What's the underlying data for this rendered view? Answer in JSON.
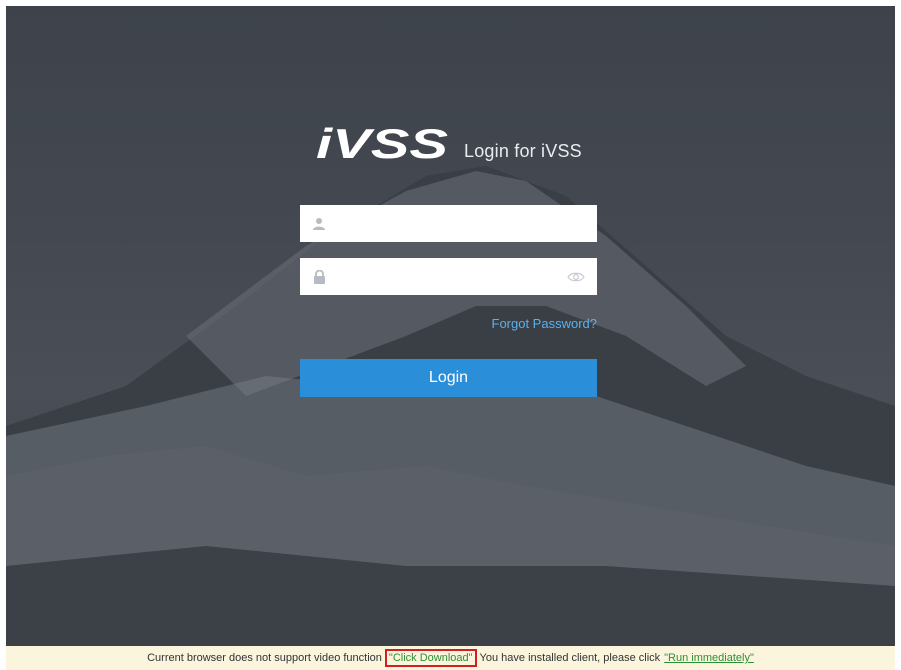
{
  "app": {
    "logo_text": "iVSS",
    "title": "Login for iVSS"
  },
  "login": {
    "username_value": "",
    "password_value": "",
    "forgot_label": "Forgot Password?",
    "login_label": "Login"
  },
  "notice": {
    "text_before": "Current browser does not support video function",
    "download_link": "\"Click Download\"",
    "text_after": "You have installed client, please click",
    "run_link": "\"Run immediately\""
  },
  "colors": {
    "accent": "#2a8ed8",
    "link_blue": "#5ab0ee",
    "link_green": "#2e8f36",
    "notice_bg": "#fbf5dd",
    "highlight_border": "#d21f1f"
  },
  "icons": [
    "user-icon",
    "lock-icon",
    "eye-icon"
  ]
}
